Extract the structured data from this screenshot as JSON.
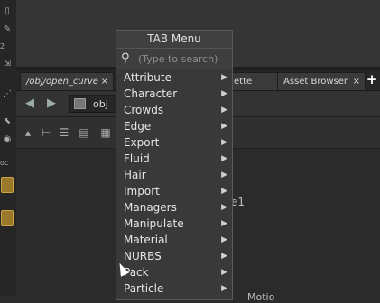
{
  "left_toolbar": {
    "labels": [
      "2",
      "oc"
    ]
  },
  "tabs": {
    "path": {
      "label": "/obj/open_curve",
      "close": "×"
    },
    "palette": {
      "label": "ette",
      "close": "×"
    },
    "asset": {
      "label": "Asset Browser",
      "close": "×"
    },
    "add": "+"
  },
  "pathbar": {
    "back": "◀",
    "forward": "▶",
    "location": "obj"
  },
  "network": {
    "node_label": "e1",
    "bottom_label": "Motio"
  },
  "tab_menu": {
    "title": "TAB Menu",
    "search_placeholder": "(Type to search)",
    "search_value": "",
    "items": [
      {
        "label": "Attribute"
      },
      {
        "label": "Character"
      },
      {
        "label": "Crowds"
      },
      {
        "label": "Edge"
      },
      {
        "label": "Export"
      },
      {
        "label": "Fluid"
      },
      {
        "label": "Hair"
      },
      {
        "label": "Import"
      },
      {
        "label": "Managers"
      },
      {
        "label": "Manipulate"
      },
      {
        "label": "Material"
      },
      {
        "label": "NURBS"
      },
      {
        "label": "Pack"
      },
      {
        "label": "Particle"
      }
    ],
    "submenu_glyph": "▶"
  },
  "colors": {
    "menu_bg": "#393939",
    "panel_bg": "#2b2b2b",
    "gold_icon": "#9a7a2a"
  }
}
